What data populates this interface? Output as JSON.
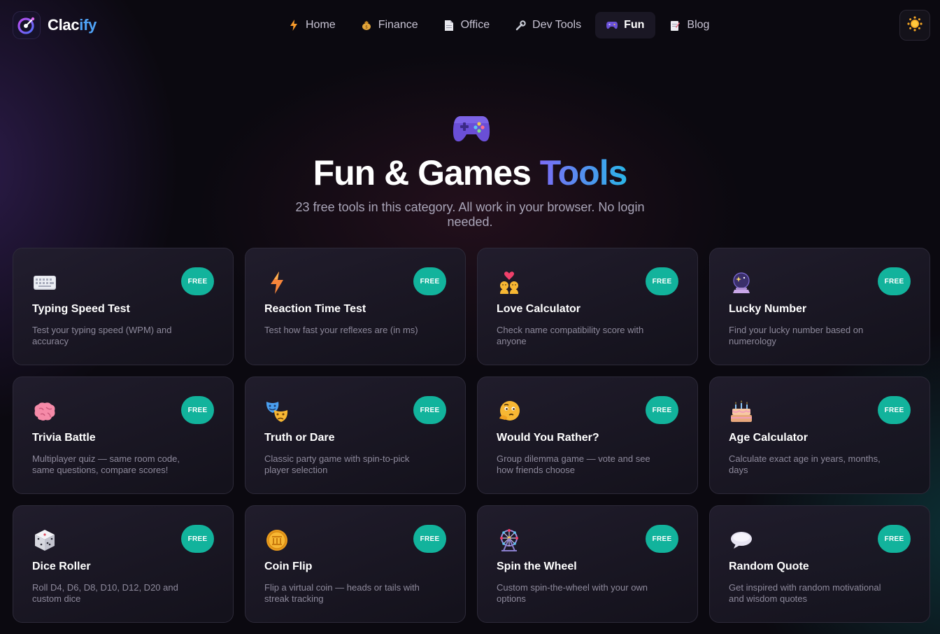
{
  "brand": {
    "name_part1": "Clac",
    "name_part2": "ify"
  },
  "nav": {
    "items": [
      {
        "label": "Home",
        "icon": "lightning-icon",
        "active": false
      },
      {
        "label": "Finance",
        "icon": "money-bag-icon",
        "active": false
      },
      {
        "label": "Office",
        "icon": "document-icon",
        "active": false
      },
      {
        "label": "Dev Tools",
        "icon": "wrench-icon",
        "active": false
      },
      {
        "label": "Fun",
        "icon": "gamepad-icon",
        "active": true
      },
      {
        "label": "Blog",
        "icon": "memo-icon",
        "active": false
      }
    ],
    "theme_toggle_icon": "sun-icon"
  },
  "hero": {
    "icon": "gamepad-icon",
    "title_main": "Fun & Games ",
    "title_accent": "Tools",
    "subtitle": "23 free tools in this category. All work in your browser. No login needed."
  },
  "badge_label": "FREE",
  "tools": [
    {
      "title": "Typing Speed Test",
      "desc": "Test your typing speed (WPM) and accuracy",
      "icon": "keyboard-icon"
    },
    {
      "title": "Reaction Time Test",
      "desc": "Test how fast your reflexes are (in ms)",
      "icon": "lightning-icon"
    },
    {
      "title": "Love Calculator",
      "desc": "Check name compatibility score with anyone",
      "icon": "couple-heart-icon"
    },
    {
      "title": "Lucky Number",
      "desc": "Find your lucky number based on numerology",
      "icon": "crystal-ball-icon"
    },
    {
      "title": "Trivia Battle",
      "desc": "Multiplayer quiz — same room code, same questions, compare scores!",
      "icon": "brain-icon"
    },
    {
      "title": "Truth or Dare",
      "desc": "Classic party game with spin-to-pick player selection",
      "icon": "theater-masks-icon"
    },
    {
      "title": "Would You Rather?",
      "desc": "Group dilemma game — vote and see how friends choose",
      "icon": "thinking-face-icon"
    },
    {
      "title": "Age Calculator",
      "desc": "Calculate exact age in years, months, days",
      "icon": "birthday-cake-icon"
    },
    {
      "title": "Dice Roller",
      "desc": "Roll D4, D6, D8, D10, D12, D20 and custom dice",
      "icon": "dice-icon"
    },
    {
      "title": "Coin Flip",
      "desc": "Flip a virtual coin — heads or tails with streak tracking",
      "icon": "coin-icon"
    },
    {
      "title": "Spin the Wheel",
      "desc": "Custom spin-the-wheel with your own options",
      "icon": "ferris-wheel-icon"
    },
    {
      "title": "Random Quote",
      "desc": "Get inspired with random motivational and wisdom quotes",
      "icon": "speech-bubble-icon"
    }
  ],
  "colors": {
    "accent_start": "#7b6cf6",
    "accent_end": "#2bb5e8",
    "badge": "#12b39c",
    "brand_blue": "#4fa3f7"
  }
}
